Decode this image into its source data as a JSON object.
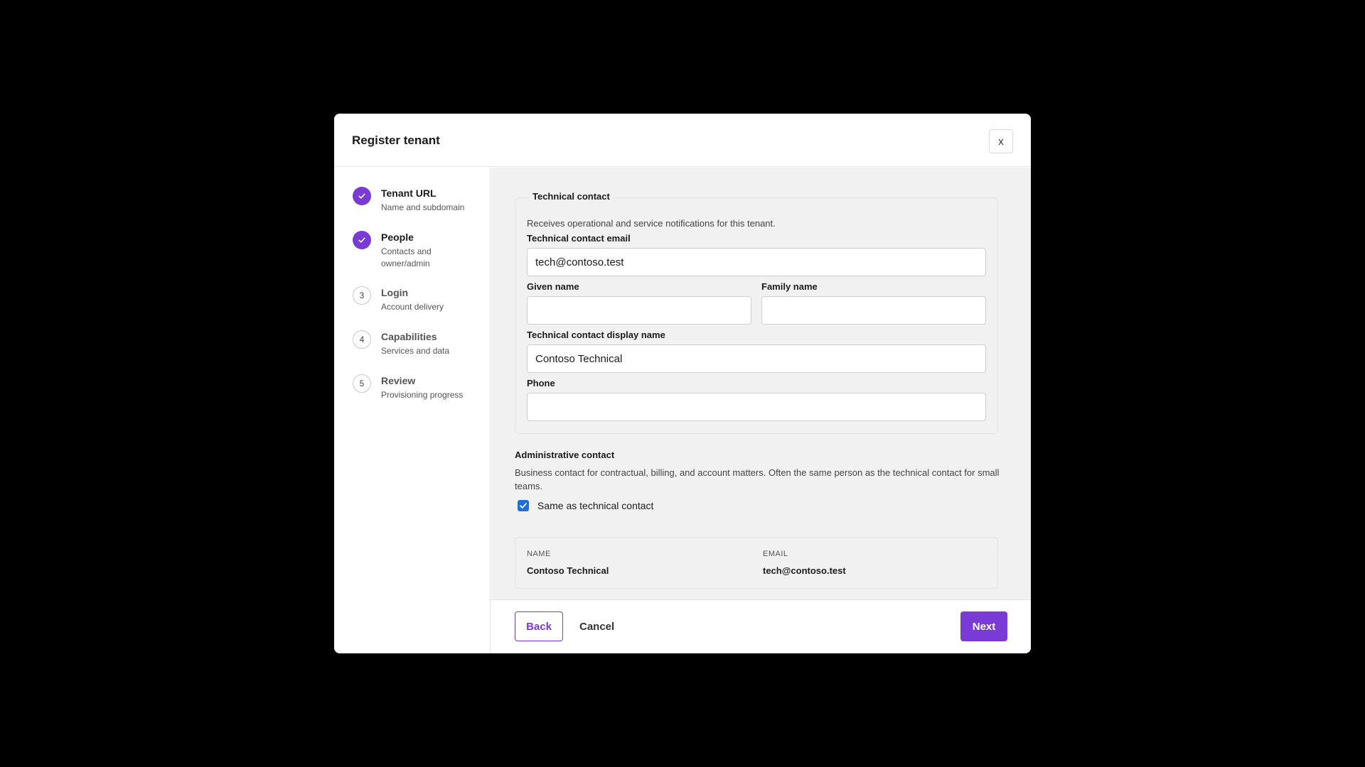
{
  "colors": {
    "accent": "#7a3ad6",
    "checkbox": "#1f6fd6",
    "backdrop": "#000000",
    "panel": "#f1f1f1"
  },
  "dialog": {
    "title": "Register tenant",
    "close_label": "x"
  },
  "steps": [
    {
      "marker": "",
      "state": "done",
      "title": "Tenant URL",
      "subtitle": "Name and subdomain",
      "icon": "check-icon"
    },
    {
      "marker": "",
      "state": "done",
      "title": "People",
      "subtitle": "Contacts and owner/admin",
      "icon": "check-icon"
    },
    {
      "marker": "3",
      "state": "todo",
      "title": "Login",
      "subtitle": "Account delivery"
    },
    {
      "marker": "4",
      "state": "todo",
      "title": "Capabilities",
      "subtitle": "Services and data"
    },
    {
      "marker": "5",
      "state": "todo",
      "title": "Review",
      "subtitle": "Provisioning progress"
    }
  ],
  "technical": {
    "legend": "Technical contact",
    "description": "Receives operational and service notifications for this tenant.",
    "email_label": "Technical contact email",
    "email_value": "tech@contoso.test",
    "given_label": "Given name",
    "given_value": "",
    "family_label": "Family name",
    "family_value": "",
    "display_label": "Technical contact display name",
    "display_value": "Contoso Technical",
    "phone_label": "Phone",
    "phone_value": ""
  },
  "administrative": {
    "title": "Administrative contact",
    "description": "Business contact for contractual, billing, and account matters. Often the same person as the technical contact for small teams.",
    "same_label": "Same as technical contact",
    "same_checked": true,
    "summary": {
      "name_label": "NAME",
      "name_value": "Contoso Technical",
      "email_label": "EMAIL",
      "email_value": "tech@contoso.test"
    }
  },
  "footer": {
    "back_label": "Back",
    "cancel_label": "Cancel",
    "next_label": "Next"
  }
}
